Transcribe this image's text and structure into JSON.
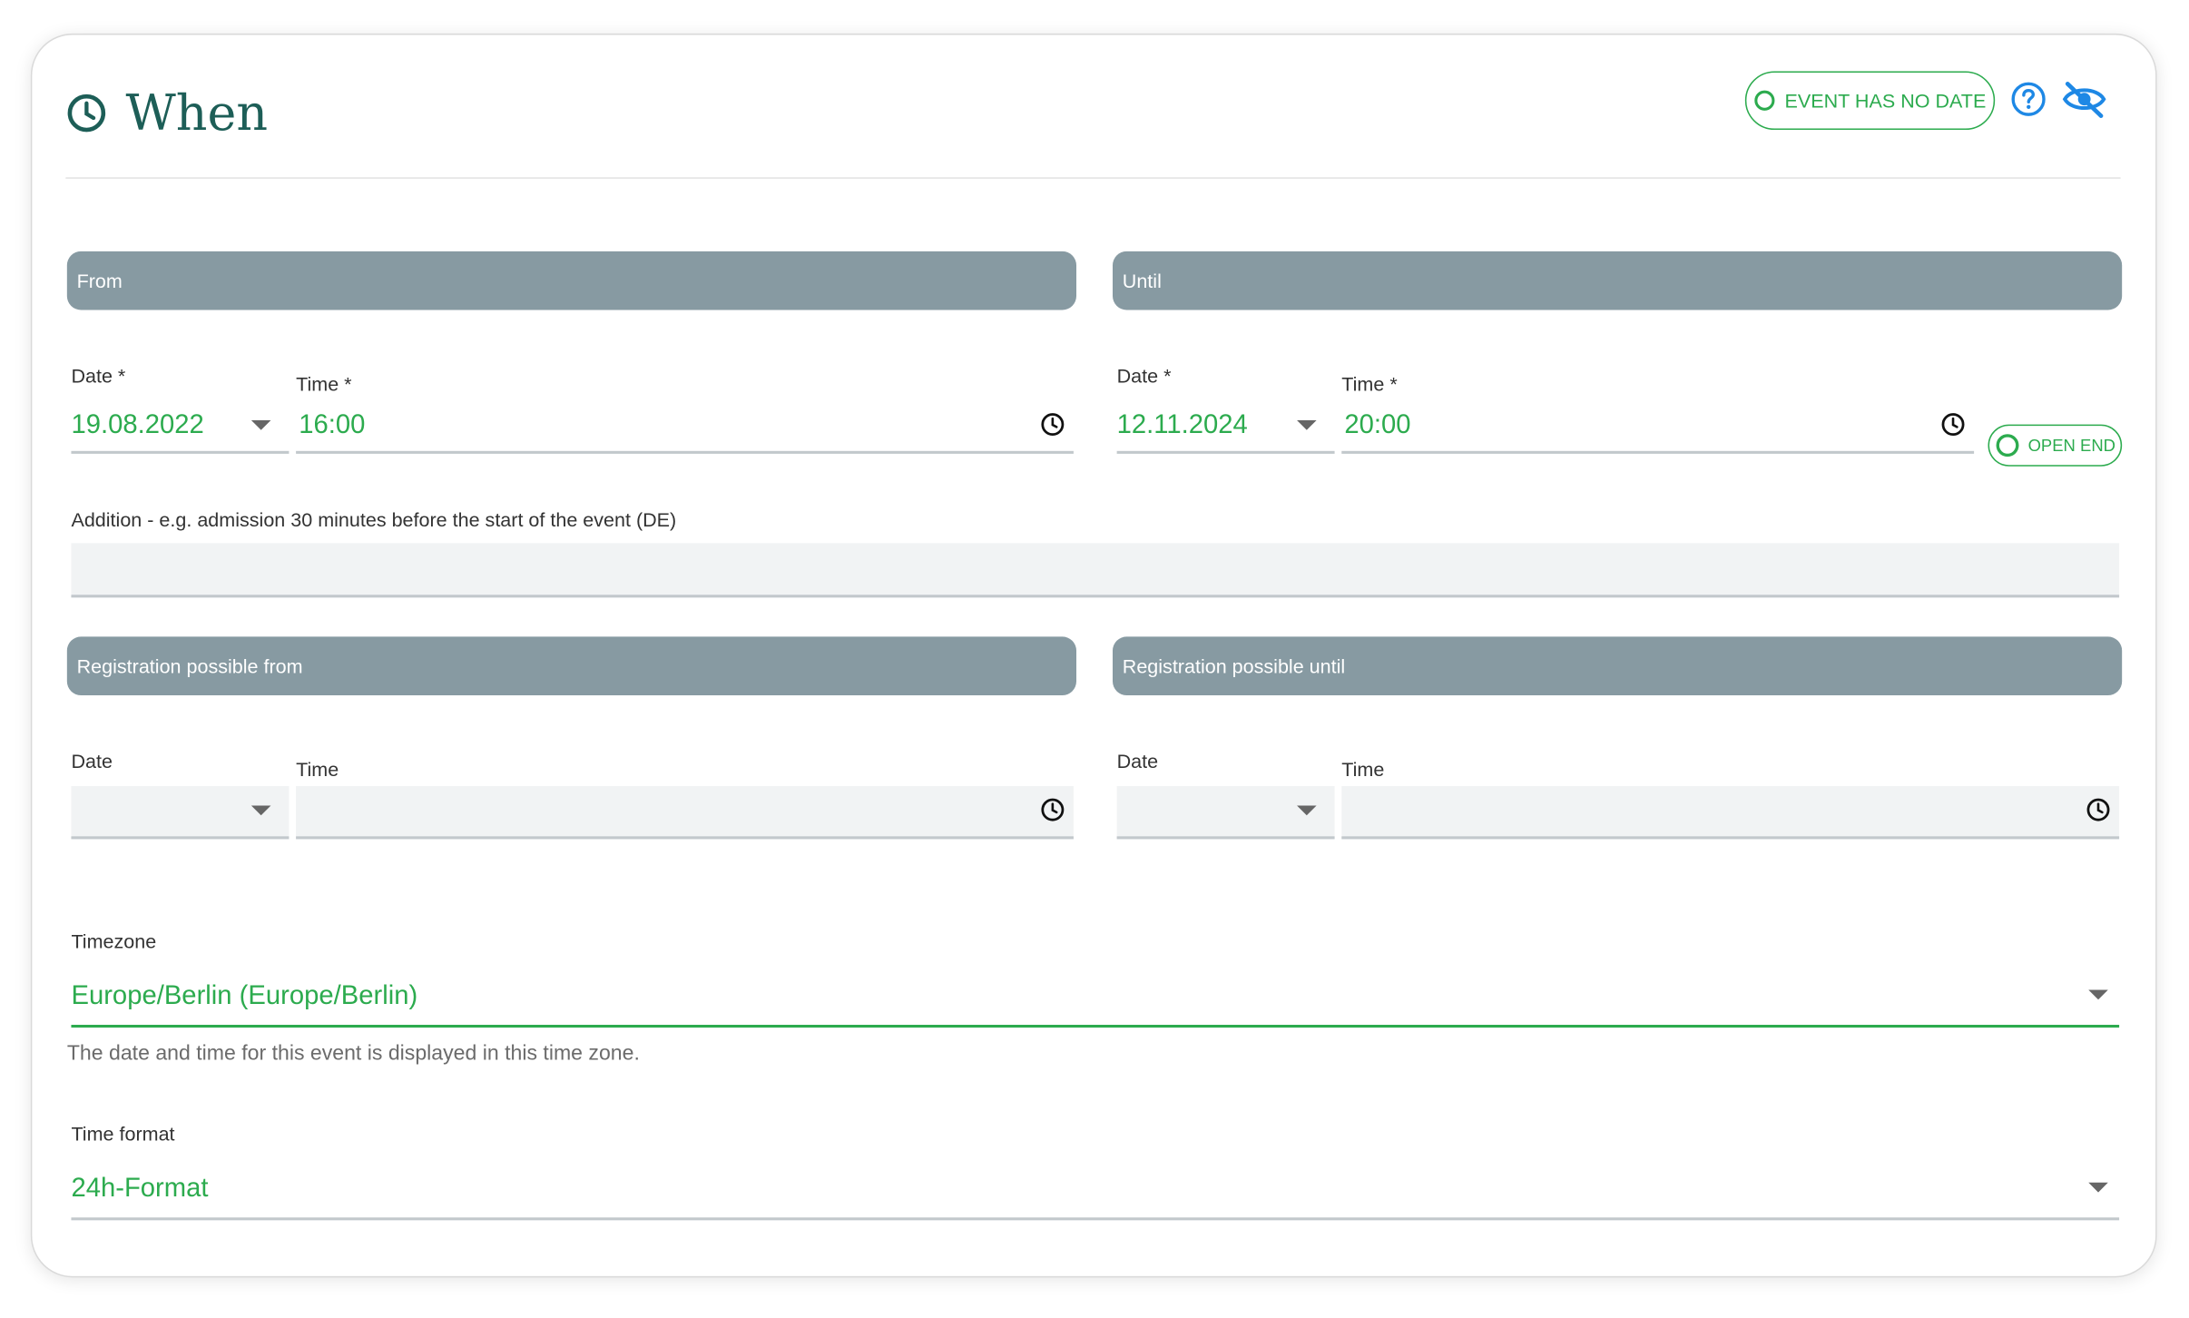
{
  "header": {
    "title": "When",
    "no_date_button": "EVENT HAS NO DATE"
  },
  "from": {
    "section_label": "From",
    "date_label": "Date *",
    "time_label": "Time *",
    "date_value": "19.08.2022",
    "time_value": "16:00"
  },
  "until": {
    "section_label": "Until",
    "date_label": "Date *",
    "time_label": "Time *",
    "date_value": "12.11.2024",
    "time_value": "20:00",
    "open_end_button": "OPEN END"
  },
  "addition": {
    "label": "Addition - e.g. admission 30 minutes before the start of the event (DE)",
    "value": ""
  },
  "registration_from": {
    "section_label": "Registration possible from",
    "date_label": "Date",
    "time_label": "Time",
    "date_value": "",
    "time_value": ""
  },
  "registration_until": {
    "section_label": "Registration possible until",
    "date_label": "Date",
    "time_label": "Time",
    "date_value": "",
    "time_value": ""
  },
  "timezone": {
    "label": "Timezone",
    "value": "Europe/Berlin (Europe/Berlin)",
    "hint": "The date and time for this event is displayed in this time zone."
  },
  "time_format": {
    "label": "Time format",
    "value": "24h-Format"
  },
  "icons": {
    "title": "clock-icon",
    "help": "question-circle-icon",
    "visibility": "eye-off-icon",
    "toggle": "ring-icon",
    "dropdown": "caret-down-icon",
    "time": "clock-icon"
  },
  "colors": {
    "accent_green": "#2cab4e",
    "title_teal": "#1d5e57",
    "section_bar": "#879aa2",
    "icon_blue": "#1e88e5"
  }
}
